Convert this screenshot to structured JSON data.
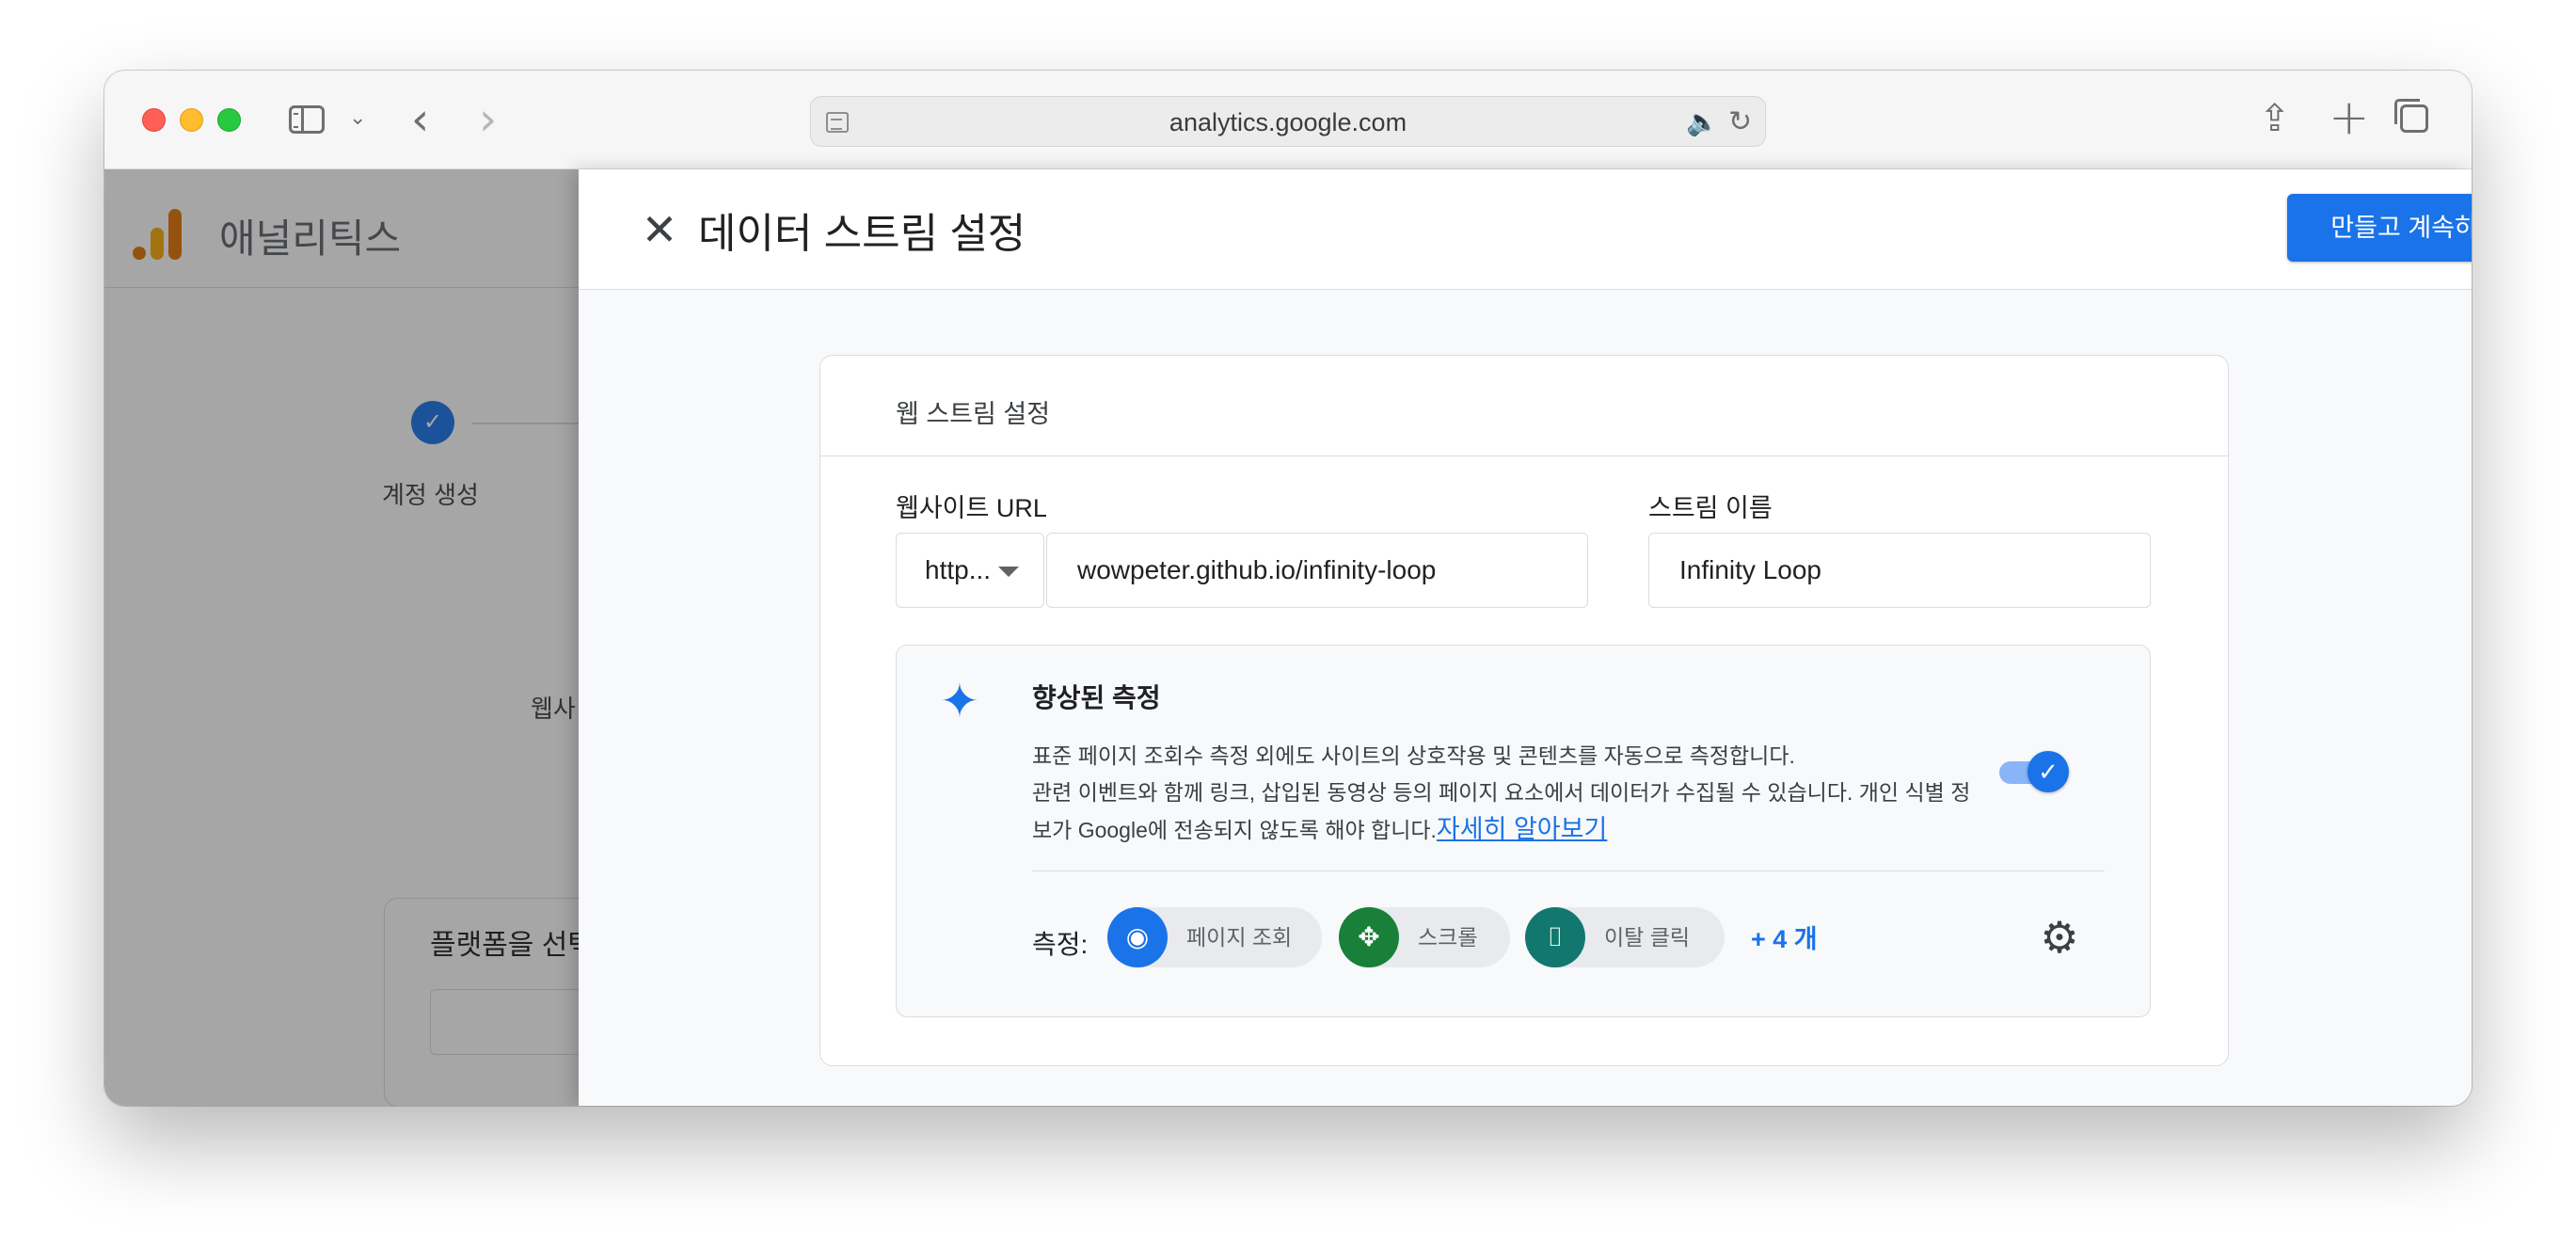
{
  "browser": {
    "url": "analytics.google.com",
    "icons": [
      "sidebar-icon",
      "chevron-down-icon",
      "back-icon",
      "forward-icon",
      "reader-icon",
      "speaker-icon",
      "reload-icon",
      "share-icon",
      "new-tab-icon",
      "tabs-overview-icon"
    ]
  },
  "app": {
    "name": "애널리틱스",
    "steps": [
      {
        "label": "계정 생성",
        "status": "complete"
      }
    ],
    "partial_label": "웹사",
    "platform_title": "플랫폼을 선택"
  },
  "dialog": {
    "title": "데이터 스트림 설정",
    "primary_button": "만들고 계속하기",
    "section_heading": "웹 스트림 설정",
    "website_url_label": "웹사이트 URL",
    "protocol_value": "http...",
    "website_url_value": "wowpeter.github.io/infinity-loop",
    "stream_name_label": "스트림 이름",
    "stream_name_value": "Infinity Loop",
    "enhanced": {
      "title": "향상된 측정",
      "description_1": "표준 페이지 조회수 측정 외에도 사이트의 상호작용 및 콘텐츠를 자동으로 측정합니다.",
      "description_2": "관련 이벤트와 함께 링크, 삽입된 동영상 등의 페이지 요소에서 데이터가 수집될 수 있습니다. 개인 식별 정보가 Google에 전송되지 않도록 해야 합니다.",
      "learn_more": "자세히 알아보기",
      "toggle_on": true,
      "measurements_label": "측정:",
      "chips": [
        {
          "label": "페이지 조회",
          "icon": "eye-icon",
          "color": "#1a73e8"
        },
        {
          "label": "스크롤",
          "icon": "scroll-icon",
          "color": "#188038"
        },
        {
          "label": "이탈 클릭",
          "icon": "mouse-icon",
          "color": "#12786f"
        }
      ],
      "more": "+ 4 개"
    }
  },
  "colors": {
    "accent": "#1a73e8",
    "ga_orange": "#e37400",
    "ga_yellow": "#f9ab00"
  }
}
